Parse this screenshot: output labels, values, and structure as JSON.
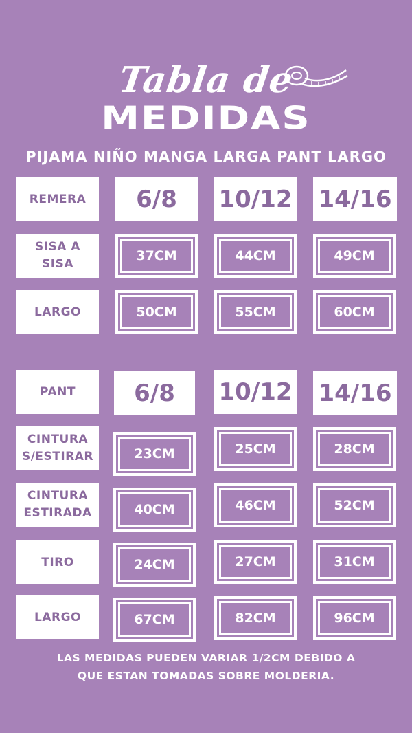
{
  "header": {
    "title_script": "Tabla de",
    "title_main": "MEDIDAS",
    "subtitle": "PIJAMA NIÑO MANGA LARGA PANT LARGO"
  },
  "remera": {
    "label": "REMERA",
    "sizes": [
      "6/8",
      "10/12",
      "14/16"
    ],
    "rows": [
      {
        "label_line1": "SISA A",
        "label_line2": "SISA",
        "values": [
          "37CM",
          "44CM",
          "49CM"
        ]
      },
      {
        "label_line1": "LARGO",
        "label_line2": "",
        "values": [
          "50CM",
          "55CM",
          "60CM"
        ]
      }
    ]
  },
  "pant": {
    "label": "PANT",
    "sizes": [
      "6/8",
      "10/12",
      "14/16"
    ],
    "rows": [
      {
        "label_line1": "CINTURA",
        "label_line2": "S/ESTIRAR",
        "values": [
          "23CM",
          "25CM",
          "28CM"
        ]
      },
      {
        "label_line1": "CINTURA",
        "label_line2": "ESTIRADA",
        "values": [
          "40CM",
          "46CM",
          "52CM"
        ]
      },
      {
        "label_line1": "TIRO",
        "label_line2": "",
        "values": [
          "24CM",
          "27CM",
          "31CM"
        ]
      },
      {
        "label_line1": "LARGO",
        "label_line2": "",
        "values": [
          "67CM",
          "82CM",
          "96CM"
        ]
      }
    ]
  },
  "footer": {
    "line1": "LAS MEDIDAS PUEDEN VARIAR 1/2CM DEBIDO A",
    "line2": "QUE ESTAN TOMADAS SOBRE MOLDERIA."
  },
  "colors": {
    "background": "#a782b8",
    "text_accent": "#8b6a9e",
    "white": "#ffffff"
  },
  "icons": {
    "tape": "measuring-tape-icon"
  }
}
